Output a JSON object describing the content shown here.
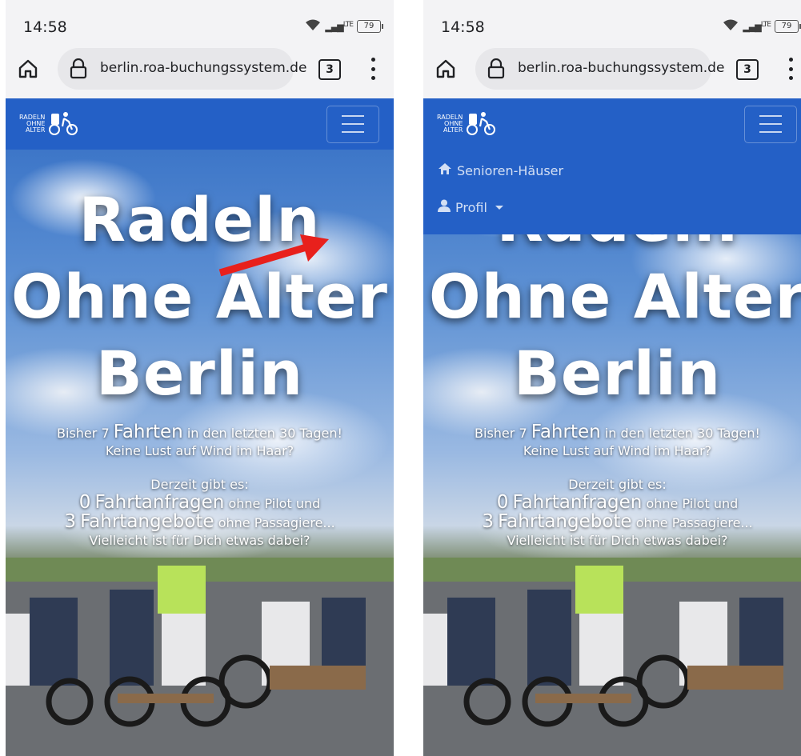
{
  "status": {
    "time": "14:58",
    "network": "LTE",
    "battery": "79"
  },
  "browser": {
    "url": "berlin.roa-buchungssystem.de",
    "tab_count": "3"
  },
  "brand": {
    "line1": "RADELN",
    "line2": "OHNE",
    "line3": "ALTER"
  },
  "hero": {
    "title_line1": "Radeln",
    "title_line2": "Ohne Alter",
    "title_line3": "Berlin",
    "stats_prefix": "Bisher 7",
    "stats_big": "Fahrten",
    "stats_suffix": "in den letzten 30 Tagen!",
    "wind_line": "Keine Lust auf Wind im Haar?",
    "derzeit": "Derzeit gibt es:",
    "requests_prefix": "0",
    "requests_big": "Fahrtanfragen",
    "requests_suffix": "ohne Pilot und",
    "offers_prefix": "3",
    "offers_big": "Fahrtangebote",
    "offers_suffix": "ohne Passagiere...",
    "closing": "Vielleicht ist für Dich etwas dabei?"
  },
  "menu": {
    "item_senioren": "Senioren-Häuser",
    "item_profil": "Profil"
  },
  "colors": {
    "navbar": "#2460c6",
    "arrow": "#e8201c"
  }
}
